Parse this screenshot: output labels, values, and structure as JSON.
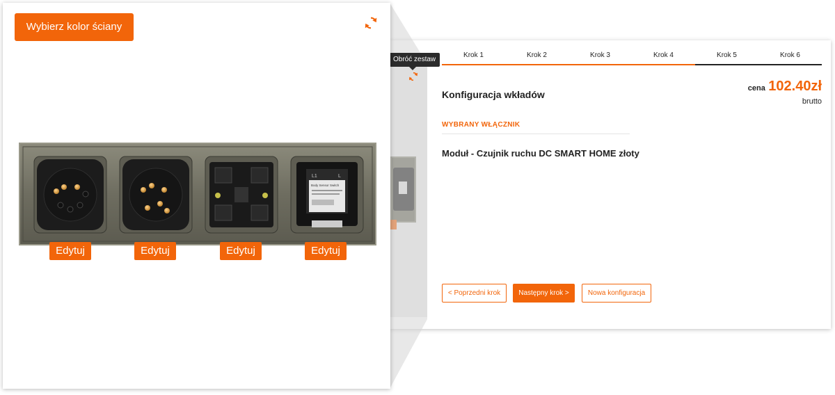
{
  "front": {
    "wall_color_button": "Wybierz kolor ściany",
    "rotate_icon": "rotate-icon",
    "edit_buttons": [
      "Edytuj",
      "Edytuj",
      "Edytuj",
      "Edytuj"
    ],
    "module_label": {
      "line1": "L1",
      "line2": "L",
      "title": "Body Sensor Switch"
    }
  },
  "back": {
    "tooltip": "Obróć zestaw",
    "steps": [
      "Krok 1",
      "Krok 2",
      "Krok 3",
      "Krok 4",
      "Krok 5",
      "Krok 6"
    ],
    "active_steps": 4,
    "section_title": "Konfiguracja wkładów",
    "price_label": "cena",
    "price_value": "102.40zł",
    "price_note": "brutto",
    "selected_label": "WYBRANY WŁĄCZNIK",
    "module_name": "Moduł - Czujnik ruchu DC SMART HOME złoty",
    "buttons": {
      "prev": "< Poprzedni krok",
      "next": "Następny krok >",
      "new": "Nowa konfiguracja"
    }
  },
  "colors": {
    "accent": "#f2650a",
    "plate": "#6b6a5c",
    "insert": "#1f1f1f",
    "contact": "#d9a24a"
  }
}
